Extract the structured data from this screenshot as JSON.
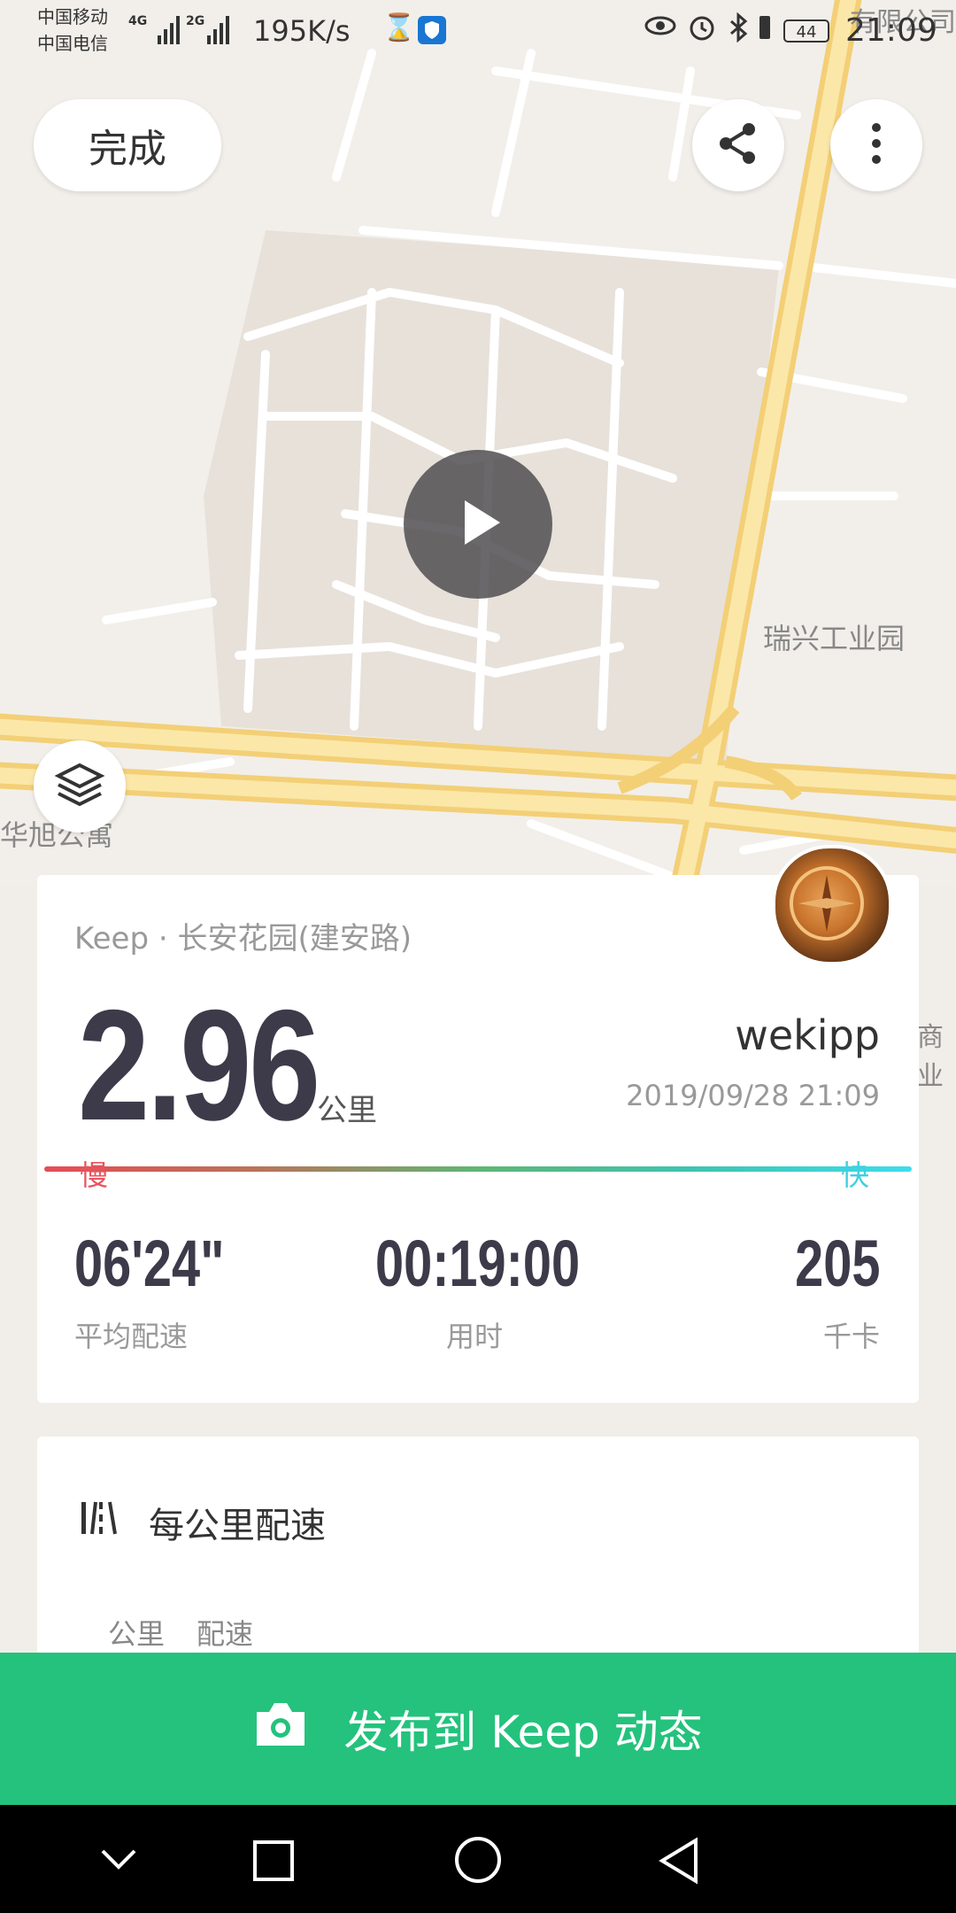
{
  "status_bar": {
    "carrier1": "中国移动",
    "carrier2": "中国电信",
    "net1": "4G",
    "net2": "2G",
    "speed": "195K/s",
    "battery": "44",
    "time": "21:09"
  },
  "toolbar": {
    "done_label": "完成"
  },
  "map": {
    "labels": [
      "瑞兴工业园",
      "华旭公寓",
      "有限公司",
      "商业"
    ]
  },
  "summary": {
    "place": "Keep · 长安花园(建安路)",
    "distance": "2.96",
    "distance_unit": "公里",
    "username": "wekipp",
    "datetime": "2019/09/28 21:09",
    "slow_label": "慢",
    "fast_label": "快",
    "stats": [
      {
        "value": "06'24\"",
        "label": "平均配速"
      },
      {
        "value": "00:19:00",
        "label": "用时"
      },
      {
        "value": "205",
        "label": "千卡"
      }
    ]
  },
  "pace_section": {
    "title": "每公里配速",
    "columns": [
      "公里",
      "配速"
    ]
  },
  "publish": {
    "label": "发布到 Keep 动态"
  },
  "colors": {
    "accent": "#24c27d",
    "slow": "#e74c55",
    "fast": "#3edcec",
    "road": "#f7d98b"
  }
}
